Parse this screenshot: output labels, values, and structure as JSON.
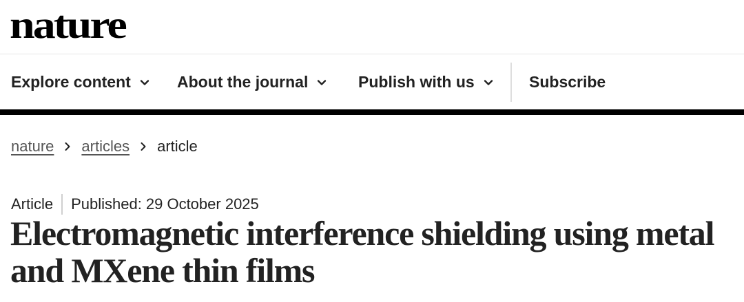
{
  "header": {
    "logo_text": "nature"
  },
  "nav": {
    "items": [
      {
        "label": "Explore content",
        "has_dropdown": true
      },
      {
        "label": "About the journal",
        "has_dropdown": true
      },
      {
        "label": "Publish with us",
        "has_dropdown": true
      },
      {
        "label": "Subscribe",
        "has_dropdown": false
      }
    ],
    "icons": {
      "dropdown": "chevron-down-icon"
    }
  },
  "breadcrumb": {
    "items": [
      {
        "label": "nature",
        "is_link": true
      },
      {
        "label": "articles",
        "is_link": true
      },
      {
        "label": "article",
        "is_link": false
      }
    ],
    "separator_icon": "chevron-right-icon"
  },
  "article": {
    "type": "Article",
    "published_label": "Published:",
    "published_date": "29 October 2025",
    "title": "Electromagnetic interference shielding using metal and MXene thin films"
  },
  "colors": {
    "text": "#222222",
    "link_muted": "#555555",
    "rule": "#000000",
    "divider": "#dedede",
    "background": "#ffffff"
  }
}
